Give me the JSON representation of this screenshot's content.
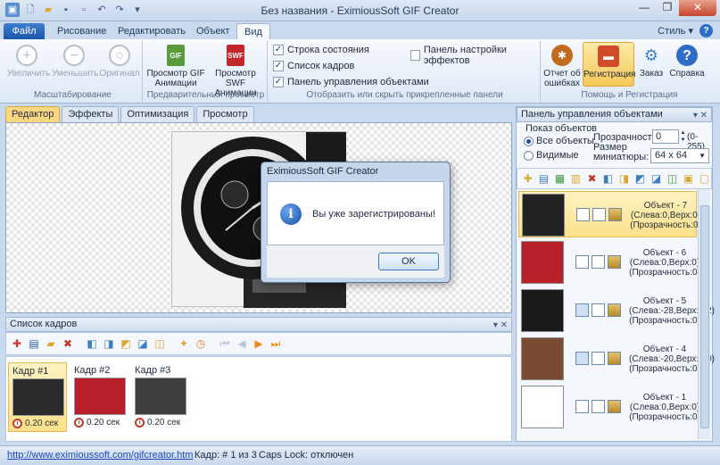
{
  "window": {
    "title": "Без названия - EximiousSoft GIF Creator",
    "minimize": "—",
    "maximize": "❐",
    "close": "✕"
  },
  "ribbon": {
    "tabs": [
      "Файл",
      "Рисование",
      "Редактировать",
      "Объект",
      "Вид"
    ],
    "style_label": "Стиль ▾",
    "help_mini": "?",
    "zoom_group": {
      "caption": "Масштабирование",
      "zoom_in": "Увеличить",
      "zoom_out": "Уменьшить",
      "original": "Оригинал"
    },
    "preview_group": {
      "caption": "Предварительный просмотр",
      "gif_line1": "Просмотр GIF",
      "gif_line2": "Анимации",
      "swf_line1": "Просмотр SWF",
      "swf_line2": "Анимации",
      "gif_badge": "GIF",
      "swf_badge": "SWF"
    },
    "panels_group": {
      "caption": "Отобразить или скрыть прикрепленные панели",
      "statusbar": "Строка состояния",
      "frames": "Список кадров",
      "objects_panel": "Панель управления объектами",
      "effects_panel": "Панель настройки эффектов",
      "checkmark": "✓"
    },
    "help_group": {
      "caption": "Помощь и Регистрация",
      "report_line1": "Отчет об",
      "report_line2": "ошибках",
      "register": "Регистрация",
      "order": "Заказ",
      "help": "Справка"
    }
  },
  "doc_tabs": [
    "Редактор",
    "Эффекты",
    "Оптимизация",
    "Просмотр"
  ],
  "frames_panel": {
    "title": "Список кадров",
    "pin": "▾ ✕",
    "frames": [
      {
        "name": "Кадр #1",
        "delay": "0.20 сек",
        "thumb": "#2a2a2a"
      },
      {
        "name": "Кадр #2",
        "delay": "0.20 сек",
        "thumb": "#b8202a"
      },
      {
        "name": "Кадр #3",
        "delay": "0.20 сек",
        "thumb": "#3d3d3d"
      }
    ]
  },
  "objects_panel": {
    "title": "Панель управления объектами",
    "pin": "▾ ✕",
    "show_label": "Показ объектов",
    "all_objects": "Все объекты",
    "visible": "Видимые",
    "opacity_label": "Прозрачность:",
    "opacity_value": "0",
    "opacity_range": "(0-255)",
    "thumb_size_line1": "Размер",
    "thumb_size_line2": "миниатюры:",
    "thumb_size_value": "64 x 64",
    "objects": [
      {
        "name": "Объект - 7",
        "pos": "(Слева:0,Верх:0)",
        "op": "(Прозрачность:0)"
      },
      {
        "name": "Объект - 6",
        "pos": "(Слева:0,Верх:0)",
        "op": "(Прозрачность:0)"
      },
      {
        "name": "Объект - 5",
        "pos": "(Слева:-28,Верх:-12)",
        "op": "(Прозрачность:0)"
      },
      {
        "name": "Объект - 4",
        "pos": "(Слева:-20,Верх:-20)",
        "op": "(Прозрачность:0)"
      },
      {
        "name": "Объект - 1",
        "pos": "(Слева:0,Верх:0)",
        "op": "(Прозрачность:0)"
      }
    ]
  },
  "statusbar": {
    "link": "http://www.eximioussoft.com/gifcreator.htm",
    "frame": "Кадр: # 1 из 3",
    "caps": "Caps Lock: отключен"
  },
  "dialog": {
    "title": "EximiousSoft GIF Creator",
    "message": "Вы уже зарегистрированы!",
    "ok": "OK",
    "info_glyph": "i"
  },
  "colors": {
    "accent": "#1c55aa",
    "highlight": "#fde18a",
    "panel_border": "#9fb5d2"
  }
}
